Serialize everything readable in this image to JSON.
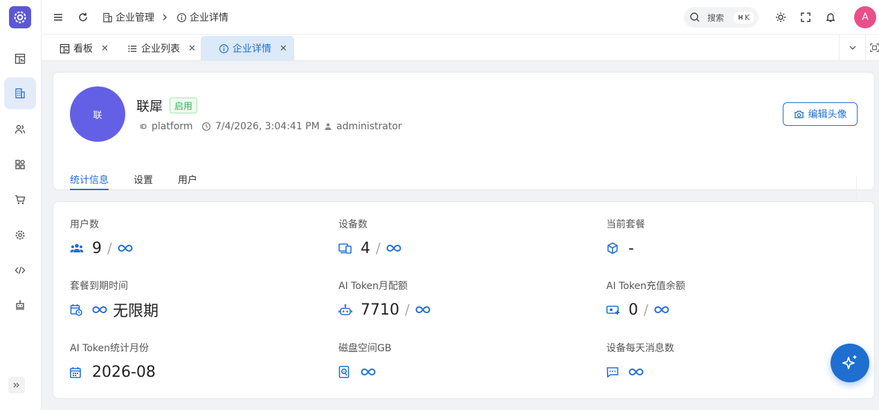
{
  "header": {
    "breadcrumb": [
      {
        "label": "企业管理",
        "icon": "building-icon"
      },
      {
        "label": "企业详情",
        "icon": "info-icon"
      }
    ],
    "search": {
      "label": "搜索",
      "shortcut": "K"
    },
    "avatar_letter": "A"
  },
  "tabs": [
    {
      "label": "看板",
      "icon": "dashboard-icon",
      "active": false
    },
    {
      "label": "企业列表",
      "icon": "list-icon",
      "active": false
    },
    {
      "label": "企业详情",
      "icon": "info-icon",
      "active": true
    }
  ],
  "enterprise": {
    "avatar_text": "联",
    "name": "联犀",
    "status": "启用",
    "code": "platform",
    "created_time": "7/4/2026, 3:04:41 PM",
    "creator": "administrator",
    "edit_avatar_label": "编辑头像"
  },
  "sub_tabs": [
    {
      "label": "统计信息",
      "active": true
    },
    {
      "label": "设置",
      "active": false
    },
    {
      "label": "用户",
      "active": false
    }
  ],
  "stats": [
    {
      "label": "用户数",
      "value": "9",
      "limit": "∞",
      "icon": "users-icon"
    },
    {
      "label": "设备数",
      "value": "4",
      "limit": "∞",
      "icon": "devices-icon"
    },
    {
      "label": "当前套餐",
      "value": "-",
      "icon": "package-icon"
    },
    {
      "label": "套餐到期时间",
      "value": "无限期",
      "icon": "calendar-clock-icon"
    },
    {
      "label": "AI Token月配额",
      "value": "7710",
      "limit": "∞",
      "icon": "robot-icon"
    },
    {
      "label": "AI Token充值余额",
      "value": "0",
      "limit": "∞",
      "icon": "recharge-icon"
    },
    {
      "label": "AI Token统计月份",
      "value": "2026-08",
      "icon": "calendar-icon"
    },
    {
      "label": "磁盘空间GB",
      "limit": "∞",
      "icon": "disk-icon"
    },
    {
      "label": "设备每天消息数",
      "limit": "∞",
      "icon": "message-icon"
    }
  ],
  "colors": {
    "primary": "#1f6fd1",
    "logo": "#5b57d6",
    "avatar": "#6360e5",
    "user_avatar": "#e94f8a",
    "status_green": "#3aab5a"
  }
}
